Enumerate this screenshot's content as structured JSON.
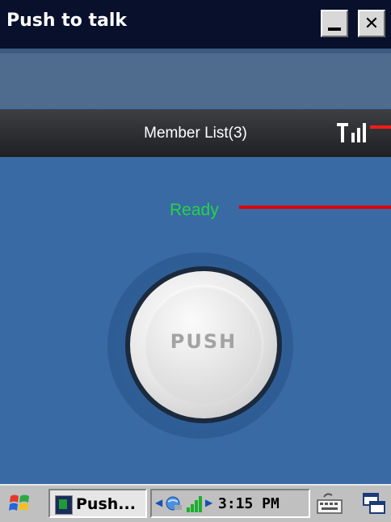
{
  "window": {
    "title": "Push to talk",
    "minimize_icon": "minimize-icon",
    "close_icon": "close-icon",
    "close_glyph": "✕"
  },
  "header": {
    "member_list_label": "Member List(3)",
    "signal_icon": "signal-strength-icon"
  },
  "status": {
    "text": "Ready",
    "color": "#22d44a"
  },
  "push_button": {
    "label": "PUSH"
  },
  "taskbar": {
    "start_icon": "windows-start-icon",
    "task_label": "Push...",
    "tray_icons": [
      "network-icon",
      "signal-bars-icon"
    ],
    "clock": "3:15 PM",
    "keyboard_icon": "keyboard-icon",
    "switcher_icon": "window-switcher-icon"
  },
  "colors": {
    "background": "#3a6aa3",
    "title_bar": "#08102c",
    "callout_line": "#ff1a1a"
  }
}
